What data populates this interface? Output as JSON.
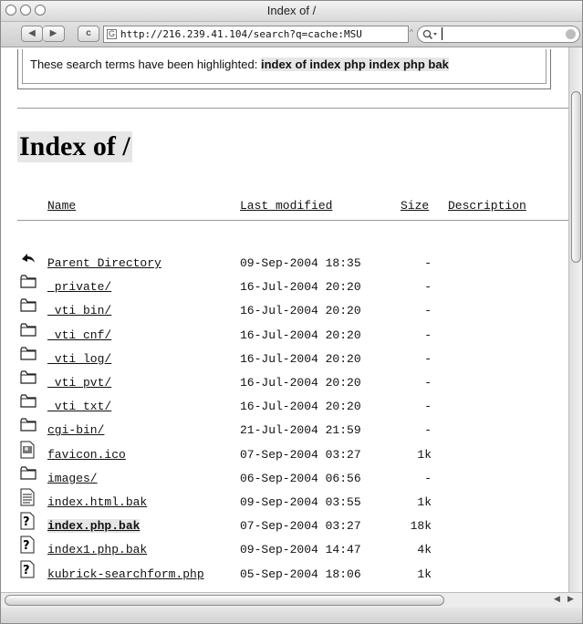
{
  "window": {
    "title": "Index of /"
  },
  "toolbar": {
    "back_glyph": "◀",
    "forward_glyph": "▶",
    "reload_glyph": "c",
    "url": "http://216.239.41.104/search?q=cache:MSU",
    "search_value": "",
    "icons": {
      "back": "back-arrow-icon",
      "forward": "forward-arrow-icon",
      "reload": "reload-icon",
      "site": "site-favicon-icon",
      "search": "magnifier-icon",
      "search_clear": "clear-icon"
    }
  },
  "banner": {
    "prefix": "These search terms have been highlighted:",
    "terms": "index of index php index php bak"
  },
  "page": {
    "heading": "Index of /",
    "columns": {
      "name": "Name",
      "modified": "Last modified",
      "size": "Size",
      "description": "Description"
    },
    "rows": [
      {
        "icon": "back-arrow-icon",
        "name": "Parent Directory",
        "modified": "09-Sep-2004 18:35",
        "size": "-"
      },
      {
        "icon": "folder-icon",
        "name": "_private/",
        "modified": "16-Jul-2004 20:20",
        "size": "-"
      },
      {
        "icon": "folder-icon",
        "name": "_vti_bin/",
        "modified": "16-Jul-2004 20:20",
        "size": "-"
      },
      {
        "icon": "folder-icon",
        "name": "_vti_cnf/",
        "modified": "16-Jul-2004 20:20",
        "size": "-"
      },
      {
        "icon": "folder-icon",
        "name": "_vti_log/",
        "modified": "16-Jul-2004 20:20",
        "size": "-"
      },
      {
        "icon": "folder-icon",
        "name": "_vti_pvt/",
        "modified": "16-Jul-2004 20:20",
        "size": "-"
      },
      {
        "icon": "folder-icon",
        "name": "_vti_txt/",
        "modified": "16-Jul-2004 20:20",
        "size": "-"
      },
      {
        "icon": "folder-icon",
        "name": "cgi-bin/",
        "modified": "21-Jul-2004 21:59",
        "size": "-"
      },
      {
        "icon": "image-file-icon",
        "name": "favicon.ico",
        "modified": "07-Sep-2004 03:27",
        "size": "1k"
      },
      {
        "icon": "folder-icon",
        "name": "images/",
        "modified": "06-Sep-2004 06:56",
        "size": "-"
      },
      {
        "icon": "text-file-icon",
        "name": "index.html.bak",
        "modified": "09-Sep-2004 03:55",
        "size": "1k"
      },
      {
        "icon": "unknown-file-icon",
        "name": "index.php.bak",
        "modified": "07-Sep-2004 03:27",
        "size": "18k",
        "highlighted": true
      },
      {
        "icon": "unknown-file-icon",
        "name": "index1.php.bak",
        "modified": "09-Sep-2004 14:47",
        "size": "4k"
      },
      {
        "icon": "unknown-file-icon",
        "name": "kubrick-searchform.php",
        "modified": "05-Sep-2004 18:06",
        "size": "1k"
      }
    ]
  }
}
